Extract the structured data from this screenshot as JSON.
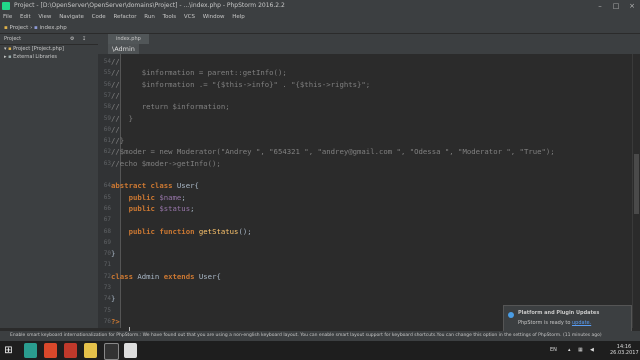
{
  "window": {
    "title": "Project - [D:\\OpenServer\\OpenServer\\domains\\Project] - ...\\index.php - PhpStorm 2016.2.2",
    "controls": [
      "–",
      "□",
      "×"
    ]
  },
  "menu": [
    "File",
    "Edit",
    "View",
    "Navigate",
    "Code",
    "Refactor",
    "Run",
    "Tools",
    "VCS",
    "Window",
    "Help"
  ],
  "nav": {
    "project": "Project",
    "file": "index.php"
  },
  "sidebar": {
    "tab": "Project",
    "items": [
      {
        "label": "Project [Project.php]"
      },
      {
        "label": "External Libraries"
      }
    ]
  },
  "editor": {
    "tab": "index.php",
    "breadcrumb": "\\Admin"
  },
  "code_lines": [
    {
      "n": "54",
      "html": "<span class=\"cm\">//</span>"
    },
    {
      "n": "55",
      "html": "<span class=\"cm\">//     $information = parent::getInfo();</span>"
    },
    {
      "n": "56",
      "html": "<span class=\"cm\">//     $information .= \"{$this->info}\" . \"{$this->rights}\";</span>"
    },
    {
      "n": "57",
      "html": "<span class=\"cm\">//</span>"
    },
    {
      "n": "58",
      "html": "<span class=\"cm\">//     return $information;</span>"
    },
    {
      "n": "59",
      "html": "<span class=\"cm\">//  }</span>"
    },
    {
      "n": "60",
      "html": "<span class=\"cm\">//</span>"
    },
    {
      "n": "61",
      "html": "<span class=\"cm\">//}</span>"
    },
    {
      "n": "62",
      "html": "<span class=\"cm\">//$moder = new Moderator(\"Andrey \", \"654321 \", \"andrey@gmail.com \", \"Odessa \", \"Moderator \", \"True\");</span>"
    },
    {
      "n": "63",
      "html": "<span class=\"cm\">//echo $moder->getInfo();</span>"
    },
    {
      "n": "",
      "html": ""
    },
    {
      "n": "64",
      "html": "<span class=\"kw\">abstract class</span> User{"
    },
    {
      "n": "65",
      "html": "    <span class=\"kw\">public</span> <span class=\"vr\">$name</span>;"
    },
    {
      "n": "66",
      "html": "    <span class=\"kw\">public</span> <span class=\"vr\">$status</span>;"
    },
    {
      "n": "67",
      "html": ""
    },
    {
      "n": "68",
      "html": "    <span class=\"kw\">public function</span> <span class=\"fn\">getStatus</span>();"
    },
    {
      "n": "69",
      "html": ""
    },
    {
      "n": "70",
      "html": "}"
    },
    {
      "n": "71",
      "html": ""
    },
    {
      "n": "72",
      "html": "<span class=\"kw\">class</span> Admin <span class=\"kw\">extends</span> User{"
    },
    {
      "n": "73",
      "html": ""
    },
    {
      "n": "74",
      "html": "}"
    },
    {
      "n": "75",
      "html": ""
    },
    {
      "n": "76",
      "html": "<span class=\"kw\">?&gt;</span>"
    }
  ],
  "notification": {
    "title": "Platform and Plugin Updates",
    "text": "PhpStorm is ready to",
    "link": "update."
  },
  "status": {
    "message": "Enable smart keyboard internationalization for PhpStorm.: We have found out that you are using a non-english keyboard layout. You can enable smart layout support for keyboard shortcuts.You can change this option in the settings of PhpStorm. (11 minutes ago)"
  },
  "taskbar": {
    "lang": "EN",
    "time": "14:16",
    "date": "26.03.2017"
  },
  "colors": {
    "editor_bg": "#2b2b2b",
    "keyword": "#cc7832",
    "comment": "#808080",
    "variable": "#9876aa",
    "function": "#ffc66d"
  }
}
